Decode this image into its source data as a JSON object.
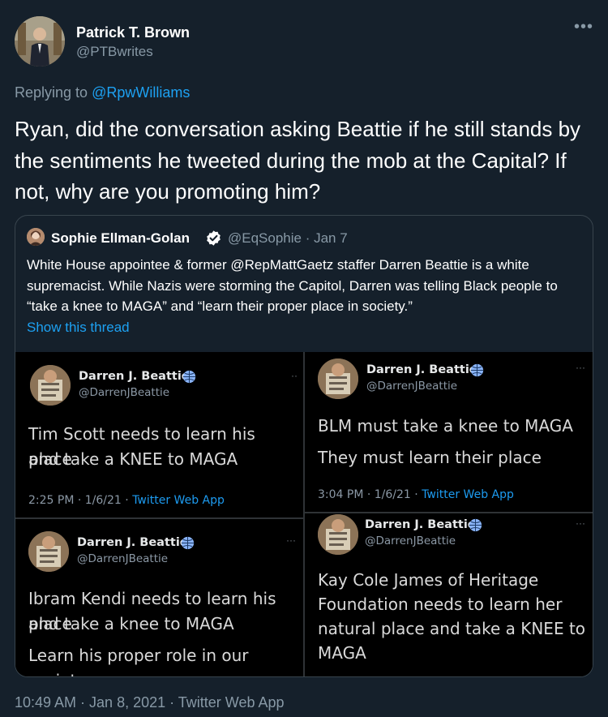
{
  "tweet": {
    "author_name": "Patrick T. Brown",
    "author_handle": "@PTBwrites",
    "more_icon": "more-horizontal-icon",
    "replying_prefix": "Replying to",
    "replying_to": "@RpwWilliams",
    "text": "Ryan, did the conversation asking Beattie if he still stands by the sentiments he tweeted during the mob at the Capital? If not, why are you promoting him?",
    "timestamp": "10:49 AM · Jan 8, 2021 · Twitter Web App"
  },
  "quote": {
    "author_name": "Sophie Ellman-Golan",
    "verified_icon": "verified-badge-icon",
    "handle_date": "@EqSophie · Jan 7",
    "text": "White House appointee & former @RepMattGaetz staffer Darren Beattie is a white supremacist. While Nazis were storming the Capitol, Darren was telling Black people to “take a knee to MAGA” and “learn their proper place in society.”",
    "show_thread": "Show this thread"
  },
  "screenshots": [
    {
      "name": "Darren J. Beattie",
      "handle": "@DarrenJBeattie",
      "line1": "Tim Scott needs to learn his place",
      "line2": "and take a KNEE to MAGA",
      "line3": "",
      "meta_time": "2:25 PM · 1/6/21 · ",
      "meta_app": "Twitter Web App"
    },
    {
      "name": "Darren J. Beattie",
      "handle": "@DarrenJBeattie",
      "line1": "BLM must take a knee to MAGA",
      "line2": "They must learn their place",
      "line3": "",
      "meta_time": "3:04 PM · 1/6/21 · ",
      "meta_app": "Twitter Web App"
    },
    {
      "name": "Darren J. Beattie",
      "handle": "@DarrenJBeattie",
      "line1": "Ibram Kendi needs to learn his place",
      "line2": "and take a knee to MAGA",
      "line3": "Learn his proper role in our society",
      "meta_time": "",
      "meta_app": ""
    },
    {
      "name": "Darren J. Beattie",
      "handle": "@DarrenJBeattie",
      "line1": "Kay Cole James of Heritage",
      "line2": "Foundation needs to learn her",
      "line3": "natural place and take a KNEE to",
      "line4": "MAGA",
      "meta_time": "",
      "meta_app": ""
    }
  ]
}
